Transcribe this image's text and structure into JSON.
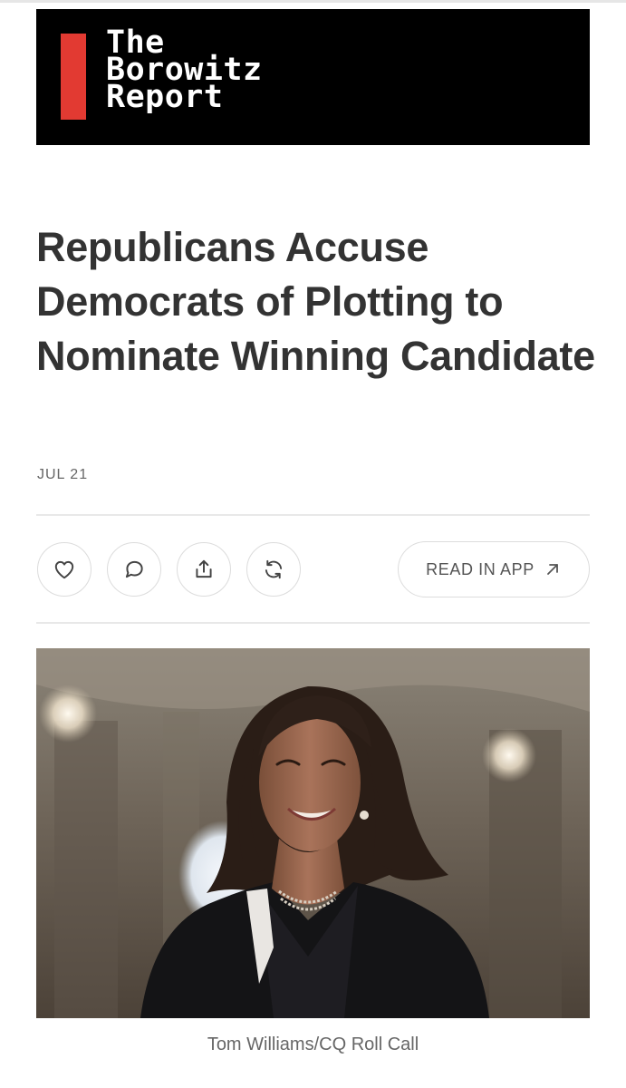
{
  "publication": {
    "line1": "The",
    "line2": "Borowitz",
    "line3": "Report"
  },
  "article": {
    "title": "Republicans Accuse Democrats of Plotting to Nominate Winning Candidate",
    "date": "JUL 21",
    "photo_credit": "Tom Williams/CQ Roll Call"
  },
  "actions": {
    "like_icon": "heart-icon",
    "comment_icon": "comment-bubble-icon",
    "share_icon": "share-upload-icon",
    "restack_icon": "restack-arrows-icon",
    "read_in_app_label": "READ IN APP",
    "read_in_app_icon": "arrow-up-right-icon"
  },
  "colors": {
    "banner_background": "#000000",
    "banner_accent": "#e23a32",
    "headline_text": "#333333",
    "muted_text": "#666666"
  }
}
